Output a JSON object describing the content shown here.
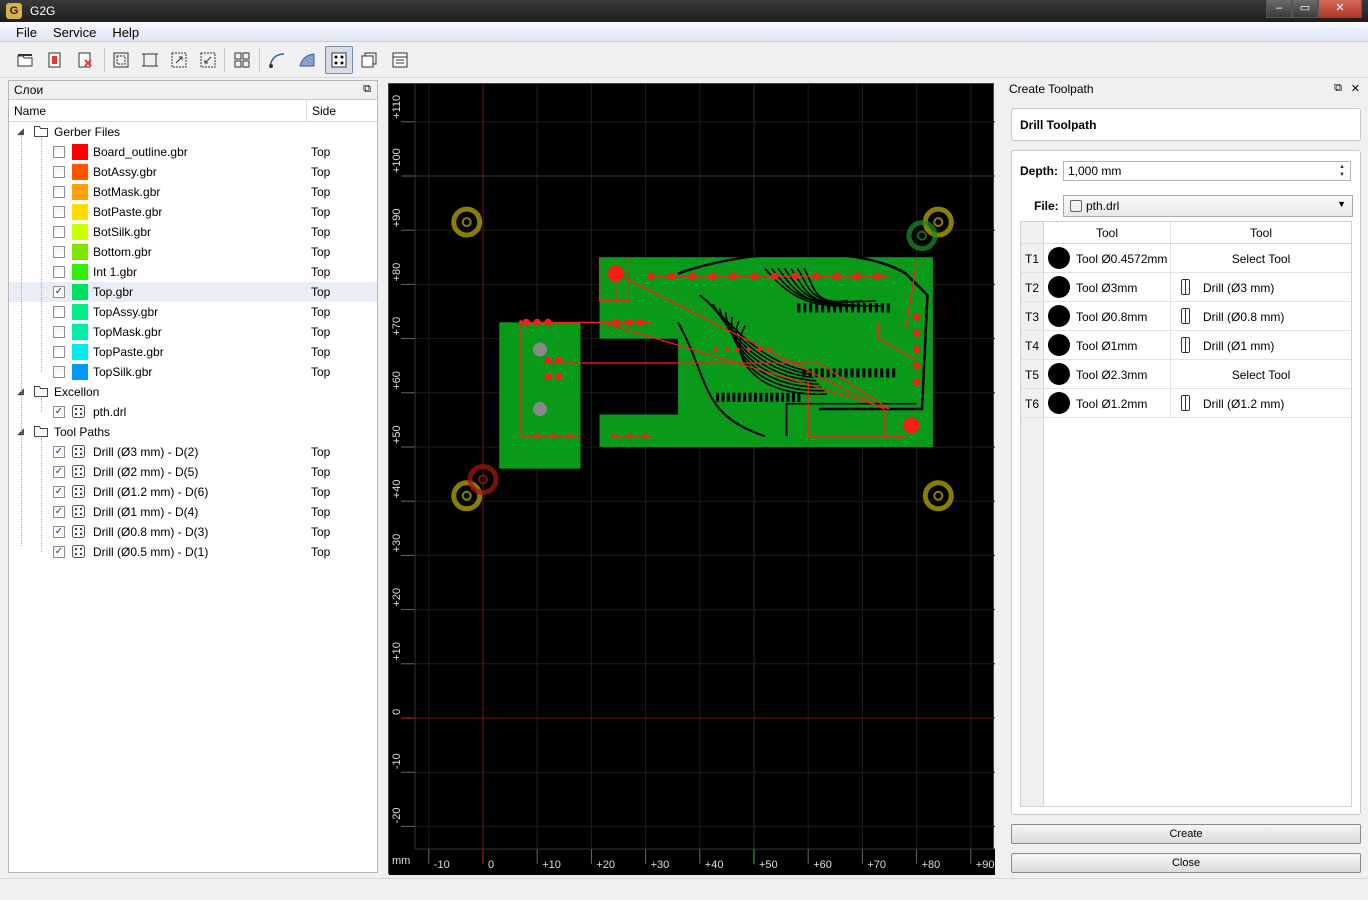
{
  "window": {
    "title": "G2G",
    "icon_text": "G",
    "btn_min": "‒",
    "btn_max": "▭",
    "btn_close": "✕"
  },
  "menu": [
    "File",
    "Service",
    "Help"
  ],
  "toolbar": [
    "open-folder-icon",
    "open-gerber-icon",
    "close-file-icon",
    "zoom-fit-icon",
    "zoom-board-icon",
    "zoom-in-icon",
    "zoom-out-icon",
    "group-icon",
    "profile-path-icon",
    "pocket-path-icon",
    "drill-path-icon",
    "layers-icon",
    "settings-icon"
  ],
  "layers_panel": {
    "title": "Слои",
    "columns": {
      "name": "Name",
      "side": "Side"
    },
    "groups": [
      {
        "name": "Gerber Files",
        "items": [
          {
            "name": "Board_outline.gbr",
            "side": "Top",
            "color": "#ff0000",
            "checked": false
          },
          {
            "name": "BotAssy.gbr",
            "side": "Top",
            "color": "#ff5500",
            "checked": false
          },
          {
            "name": "BotMask.gbr",
            "side": "Top",
            "color": "#ffa000",
            "checked": false
          },
          {
            "name": "BotPaste.gbr",
            "side": "Top",
            "color": "#ffdd00",
            "checked": false
          },
          {
            "name": "BotSilk.gbr",
            "side": "Top",
            "color": "#ccff00",
            "checked": false
          },
          {
            "name": "Bottom.gbr",
            "side": "Top",
            "color": "#7fe600",
            "checked": false
          },
          {
            "name": "Int 1.gbr",
            "side": "Top",
            "color": "#33ee00",
            "checked": false
          },
          {
            "name": "Top.gbr",
            "side": "Top",
            "color": "#00e060",
            "checked": true
          },
          {
            "name": "TopAssy.gbr",
            "side": "Top",
            "color": "#00ee88",
            "checked": false
          },
          {
            "name": "TopMask.gbr",
            "side": "Top",
            "color": "#00eeaa",
            "checked": false
          },
          {
            "name": "TopPaste.gbr",
            "side": "Top",
            "color": "#00eeee",
            "checked": false
          },
          {
            "name": "TopSilk.gbr",
            "side": "Top",
            "color": "#0099ff",
            "checked": false
          }
        ]
      },
      {
        "name": "Excellon",
        "items": [
          {
            "name": "pth.drl",
            "side": "",
            "checked": true
          }
        ]
      },
      {
        "name": "Tool Paths",
        "items": [
          {
            "name": "Drill (Ø3 mm) - D(2)",
            "side": "Top",
            "checked": true
          },
          {
            "name": "Drill (Ø2 mm) - D(5)",
            "side": "Top",
            "checked": true
          },
          {
            "name": "Drill (Ø1.2 mm) - D(6)",
            "side": "Top",
            "checked": true
          },
          {
            "name": "Drill (Ø1 mm) - D(4)",
            "side": "Top",
            "checked": true
          },
          {
            "name": "Drill (Ø0.8 mm) - D(3)",
            "side": "Top",
            "checked": true
          },
          {
            "name": "Drill (Ø0.5 mm) - D(1)",
            "side": "Top",
            "checked": true
          }
        ]
      }
    ]
  },
  "canvas": {
    "unit": "mm",
    "x_ticks": [
      "-10",
      "0",
      "+10",
      "+20",
      "+30",
      "+40",
      "+50",
      "+60",
      "+70",
      "+80",
      "+90"
    ],
    "y_ticks": [
      "+110",
      "+100",
      "+90",
      "+80",
      "+70",
      "+60",
      "+50",
      "+40",
      "+30",
      "+20",
      "+10",
      "0",
      "-10",
      "-20"
    ],
    "board_color": "#0a9a1a",
    "trace_color": "#ff1a1a"
  },
  "toolpath_panel": {
    "title": "Create Toolpath",
    "section": "Drill Toolpath",
    "depth_label": "Depth:",
    "depth_value": "1,000 mm",
    "file_label": "File:",
    "file_value": "pth.drl",
    "columns": [
      "Tool",
      "Tool"
    ],
    "tools": [
      {
        "id": "T1",
        "tool": "Tool Ø0.4572mm",
        "drill": "Select Tool",
        "has_drill": false
      },
      {
        "id": "T2",
        "tool": "Tool Ø3mm",
        "drill": "Drill (Ø3 mm)",
        "has_drill": true
      },
      {
        "id": "T3",
        "tool": "Tool Ø0.8mm",
        "drill": "Drill (Ø0.8 mm)",
        "has_drill": true
      },
      {
        "id": "T4",
        "tool": "Tool Ø1mm",
        "drill": "Drill (Ø1 mm)",
        "has_drill": true
      },
      {
        "id": "T5",
        "tool": "Tool Ø2.3mm",
        "drill": "Select Tool",
        "has_drill": false
      },
      {
        "id": "T6",
        "tool": "Tool Ø1.2mm",
        "drill": "Drill (Ø1.2 mm)",
        "has_drill": true
      }
    ],
    "create_label": "Create",
    "close_label": "Close"
  }
}
